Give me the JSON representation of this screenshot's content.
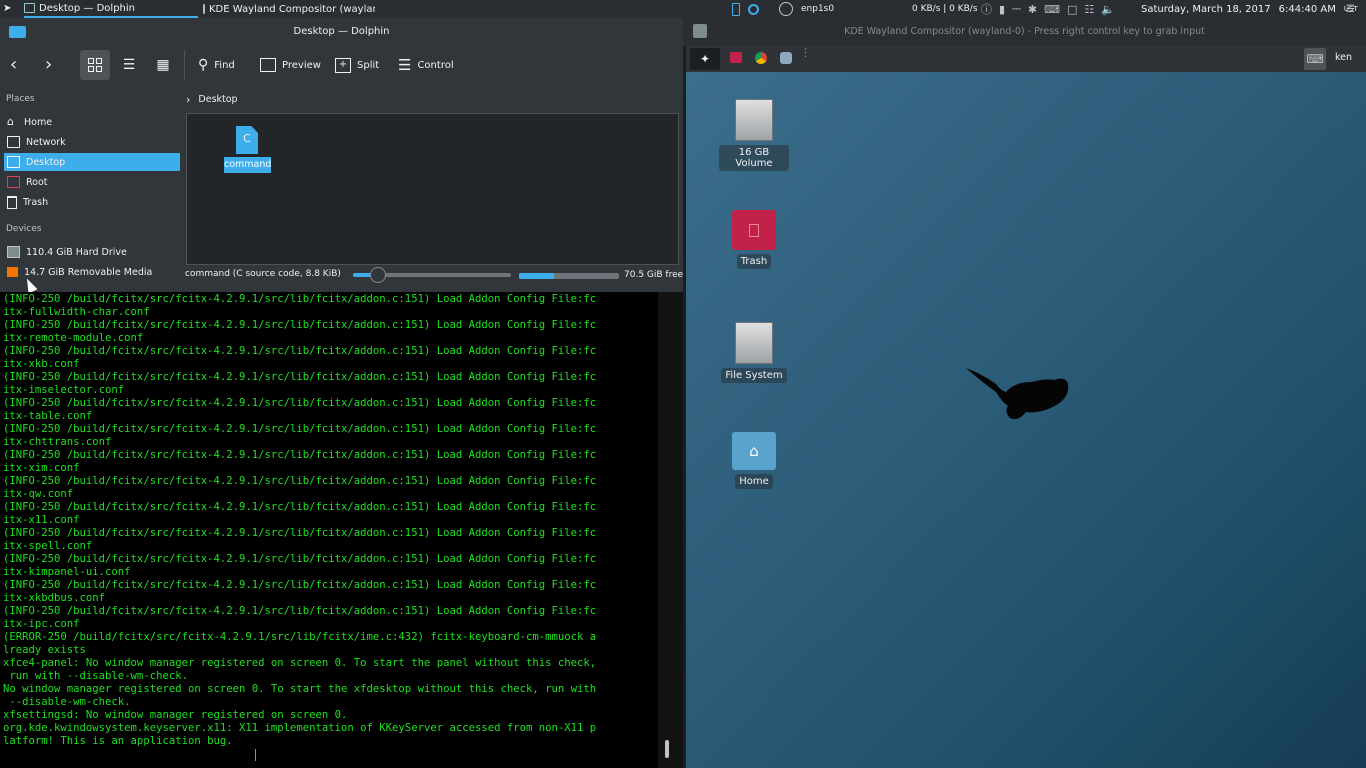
{
  "top_panel": {
    "tasks": [
      "Desktop — Dolphin",
      "KDE Wayland Compositor (waylan…"
    ],
    "network_name": "enp1s0",
    "net_speed": "0 KB/s | 0 KB/s",
    "datetime": "Saturday, March 18, 2017",
    "time": "6:44:40 AM",
    "timezone": "UST"
  },
  "dolphin": {
    "title": "Desktop — Dolphin",
    "toolbar": {
      "find": "Find",
      "preview": "Preview",
      "split": "Split",
      "control": "Control"
    },
    "places_header": "Places",
    "places": [
      "Home",
      "Network",
      "Desktop",
      "Root",
      "Trash"
    ],
    "selected_place": "Desktop",
    "devices_header": "Devices",
    "devices": [
      "110.4 GiB Hard Drive",
      "14.7 GiB Removable Media"
    ],
    "breadcrumb": "Desktop",
    "file": {
      "name": "command",
      "letter": "C"
    },
    "status_text": "command (C source code, 8.8 KiB)",
    "zoom_fraction": 0.16,
    "disk_used_fraction": 0.35,
    "free_space": "70.5 GiB free"
  },
  "terminal": {
    "lines": [
      "(INFO-250 /build/fcitx/src/fcitx-4.2.9.1/src/lib/fcitx/addon.c:151) Load Addon Config File:fc",
      "itx-fullwidth-char.conf",
      "(INFO-250 /build/fcitx/src/fcitx-4.2.9.1/src/lib/fcitx/addon.c:151) Load Addon Config File:fc",
      "itx-remote-module.conf",
      "(INFO-250 /build/fcitx/src/fcitx-4.2.9.1/src/lib/fcitx/addon.c:151) Load Addon Config File:fc",
      "itx-xkb.conf",
      "(INFO-250 /build/fcitx/src/fcitx-4.2.9.1/src/lib/fcitx/addon.c:151) Load Addon Config File:fc",
      "itx-imselector.conf",
      "(INFO-250 /build/fcitx/src/fcitx-4.2.9.1/src/lib/fcitx/addon.c:151) Load Addon Config File:fc",
      "itx-table.conf",
      "(INFO-250 /build/fcitx/src/fcitx-4.2.9.1/src/lib/fcitx/addon.c:151) Load Addon Config File:fc",
      "itx-chttrans.conf",
      "(INFO-250 /build/fcitx/src/fcitx-4.2.9.1/src/lib/fcitx/addon.c:151) Load Addon Config File:fc",
      "itx-xim.conf",
      "(INFO-250 /build/fcitx/src/fcitx-4.2.9.1/src/lib/fcitx/addon.c:151) Load Addon Config File:fc",
      "itx-qw.conf",
      "(INFO-250 /build/fcitx/src/fcitx-4.2.9.1/src/lib/fcitx/addon.c:151) Load Addon Config File:fc",
      "itx-x11.conf",
      "(INFO-250 /build/fcitx/src/fcitx-4.2.9.1/src/lib/fcitx/addon.c:151) Load Addon Config File:fc",
      "itx-spell.conf",
      "(INFO-250 /build/fcitx/src/fcitx-4.2.9.1/src/lib/fcitx/addon.c:151) Load Addon Config File:fc",
      "itx-kimpanel-ui.conf",
      "(INFO-250 /build/fcitx/src/fcitx-4.2.9.1/src/lib/fcitx/addon.c:151) Load Addon Config File:fc",
      "itx-xkbdbus.conf",
      "(INFO-250 /build/fcitx/src/fcitx-4.2.9.1/src/lib/fcitx/addon.c:151) Load Addon Config File:fc",
      "itx-ipc.conf",
      "(ERROR-250 /build/fcitx/src/fcitx-4.2.9.1/src/lib/fcitx/ime.c:432) fcitx-keyboard-cm-mmuock a",
      "lready exists",
      "xfce4-panel: No window manager registered on screen 0. To start the panel without this check,",
      " run with --disable-wm-check.",
      "No window manager registered on screen 0. To start the xfdesktop without this check, run with",
      " --disable-wm-check.",
      "xfsettingsd: No window manager registered on screen 0.",
      "org.kde.kwindowsystem.keyserver.x11: X11 implementation of KKeyServer accessed from non-X11 p",
      "latform! This is an application bug."
    ]
  },
  "wayland": {
    "title": "KDE Wayland Compositor (wayland-0) - Press right control key to grab input",
    "user": "ken",
    "desktop_icons": [
      "16 GB Volume",
      "Trash",
      "File System",
      "Home"
    ]
  },
  "colors": {
    "accent": "#3daee9",
    "terminal_text": "#1ee01e",
    "trash": "#c2224a"
  }
}
